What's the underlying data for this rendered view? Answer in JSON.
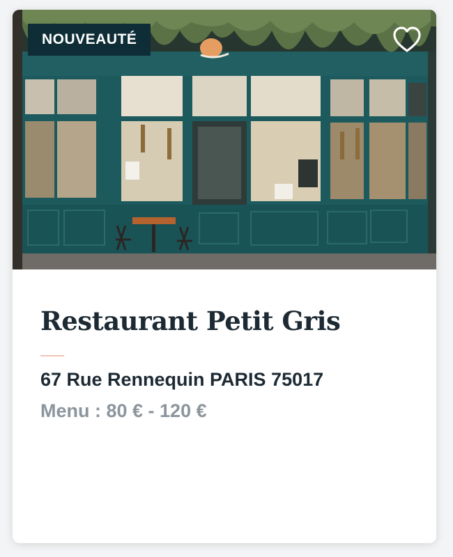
{
  "card": {
    "badge": "NOUVEAUTÉ",
    "favorite_icon": "heart-outline-icon",
    "title": "Restaurant Petit Gris",
    "address": "67 Rue Rennequin PARIS 75017",
    "price": "Menu : 80 € - 120 €"
  },
  "colors": {
    "badge_bg": "#0f2d36",
    "title": "#1d2a33",
    "muted": "#8b959d",
    "accent_rule": "#f3c3b5",
    "storefront": "#1d5a5d"
  }
}
